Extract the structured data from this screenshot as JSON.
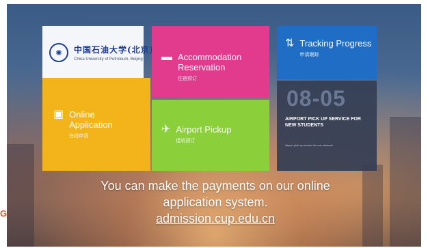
{
  "logo": {
    "cn": "中国石油大学(北京)",
    "en": "China University of Petroleum, Beijing",
    "seal": "✺"
  },
  "tiles": {
    "accommodation": {
      "title": "Accommodation Reservation",
      "subtitle": "住宿预订",
      "icon": "bed-icon",
      "color": "#e23b8e"
    },
    "tracking": {
      "title": "Tracking Progress",
      "subtitle": "申请跟踪",
      "icon": "sort-lines-icon",
      "color": "#1f6dc4"
    },
    "online": {
      "title": "Online Application",
      "subtitle": "在线申请",
      "icon": "application-icon",
      "color": "#f3b31a"
    },
    "pickup": {
      "title": "Airport Pickup",
      "subtitle": "接机预订",
      "icon": "airplane-icon",
      "color": "#8bcf3a"
    },
    "notice": {
      "date": "08-05",
      "title": "AIRPORT PICK UP SERVICE FOR NEW STUDENTS",
      "subtitle": "Airport pick up service for new students"
    }
  },
  "caption": {
    "line1": "You can make the payments on our online",
    "line2": "application system.",
    "link": "admission.cup.edu.cn"
  },
  "edge_mark": "G"
}
